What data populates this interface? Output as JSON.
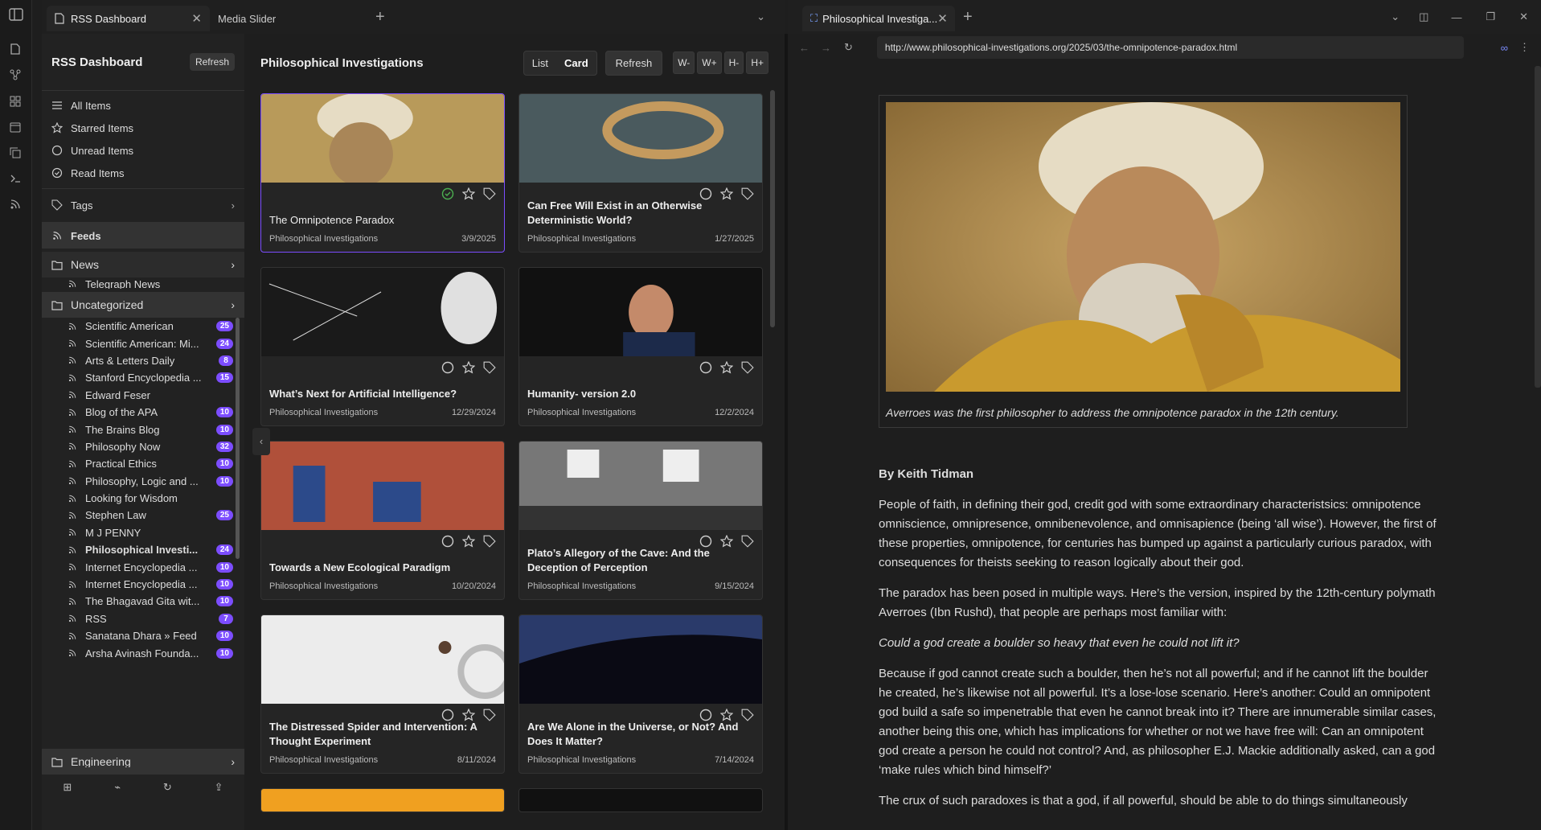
{
  "tabs": {
    "left": [
      {
        "label": "RSS Dashboard",
        "active": true
      },
      {
        "label": "Media Slider",
        "active": false
      }
    ],
    "right": [
      {
        "label": "Philosophical Investiga...",
        "active": true
      }
    ]
  },
  "sidebar": {
    "title": "RSS Dashboard",
    "refresh": "Refresh",
    "nav": [
      {
        "label": "All Items",
        "icon": "list-icon"
      },
      {
        "label": "Starred Items",
        "icon": "star-icon"
      },
      {
        "label": "Unread Items",
        "icon": "circle-icon"
      },
      {
        "label": "Read Items",
        "icon": "check-circle-icon"
      }
    ],
    "tags": "Tags",
    "feeds": "Feeds",
    "news": "News",
    "news_sub": "Telegraph News",
    "uncategorized": "Uncategorized",
    "feeds_list": [
      {
        "label": "Scientific American",
        "count": "25"
      },
      {
        "label": "Scientific American: Mi...",
        "count": "24"
      },
      {
        "label": "Arts & Letters Daily",
        "count": "8"
      },
      {
        "label": "Stanford Encyclopedia ...",
        "count": "15"
      },
      {
        "label": "Edward Feser",
        "count": ""
      },
      {
        "label": "Blog of the APA",
        "count": "10"
      },
      {
        "label": "The Brains Blog",
        "count": "10"
      },
      {
        "label": "Philosophy Now",
        "count": "32"
      },
      {
        "label": "Practical Ethics",
        "count": "10"
      },
      {
        "label": "Philosophy, Logic and ...",
        "count": "10"
      },
      {
        "label": "Looking for Wisdom",
        "count": ""
      },
      {
        "label": "Stephen Law",
        "count": "25"
      },
      {
        "label": "M J PENNY",
        "count": ""
      },
      {
        "label": "Philosophical Investi...",
        "count": "24",
        "bold": true
      },
      {
        "label": "Internet Encyclopedia ...",
        "count": "10"
      },
      {
        "label": "Internet Encyclopedia ...",
        "count": "10"
      },
      {
        "label": "The Bhagavad Gita wit...",
        "count": "10"
      },
      {
        "label": "RSS",
        "count": "7"
      },
      {
        "label": "Sanatana Dhara » Feed",
        "count": "10"
      },
      {
        "label": "Arsha Avinash Founda...",
        "count": "10"
      }
    ],
    "engineering": "Engineering"
  },
  "content": {
    "title": "Philosophical Investigations",
    "list": "List",
    "card": "Card",
    "refresh": "Refresh",
    "w_minus": "W-",
    "w_plus": "W+",
    "h_minus": "H-",
    "h_plus": "H+",
    "cards": [
      {
        "title": "The Omnipotence Paradox",
        "source": "Philosophical Investigations",
        "date": "3/9/2025",
        "read": true
      },
      {
        "title": "Can Free Will Exist in an Otherwise Deterministic World?",
        "source": "Philosophical Investigations",
        "date": "1/27/2025"
      },
      {
        "title": "What’s Next for Artificial Intelligence?",
        "source": "Philosophical Investigations",
        "date": "12/29/2024"
      },
      {
        "title": "Humanity- version 2.0",
        "source": "Philosophical Investigations",
        "date": "12/2/2024"
      },
      {
        "title": "Towards a New Ecological Paradigm",
        "source": "Philosophical Investigations",
        "date": "10/20/2024"
      },
      {
        "title": "Plato’s Allegory of the Cave: And the Deception of Perception",
        "source": "Philosophical Investigations",
        "date": "9/15/2024"
      },
      {
        "title": "The Distressed Spider and Intervention: A Thought Experiment",
        "source": "Philosophical Investigations",
        "date": "8/11/2024"
      },
      {
        "title": "Are We Alone in the Universe, or Not? And Does It Matter?",
        "source": "Philosophical Investigations",
        "date": "7/14/2024"
      }
    ]
  },
  "browser": {
    "url": "http://www.philosophical-investigations.org/2025/03/the-omnipotence-paradox.html"
  },
  "article": {
    "caption": "Averroes was the first philosopher to address the omnipotence paradox in the 12th century.",
    "author": "By Keith Tidman",
    "p1": "People of faith, in defining their god, credit god with some extraordinary characteristsics: omnipotence  omniscience, omnipresence, omnibenevolence, and omnisapience (being ‘all wise’). However, the first of these properties, omnipotence, for centuries has bumped up against a particularly curious paradox, with consequences for theists seeking to reason logically about their god.",
    "p2": "The paradox has been posed in multiple ways. Here’s the version, inspired by the 12th-century polymath Averroes (Ibn Rushd), that people are perhaps most familiar with:",
    "p3": "Could a god create a boulder so heavy that even he could not lift it?",
    "p4": "Because if god cannot create such a boulder, then he’s not all powerful; and if he cannot lift the boulder he created, he’s likewise not all powerful. It’s a lose-lose scenario. Here’s another: Could an omnipotent god build a safe so impenetrable that even he cannot break into it? There are innumerable similar cases, another being this one, which has implications for whether or not we have free will: Can an omnipotent god create a person he could not control? And, as philosopher E.J. Mackie additionally asked, can a god ‘make rules which bind himself?’",
    "p5": "The crux of such paradoxes is that a god, if all powerful, should be able to do things simultaneously"
  },
  "colors": {
    "accent": "#7c4dff",
    "bg": "#1e1e1e"
  }
}
